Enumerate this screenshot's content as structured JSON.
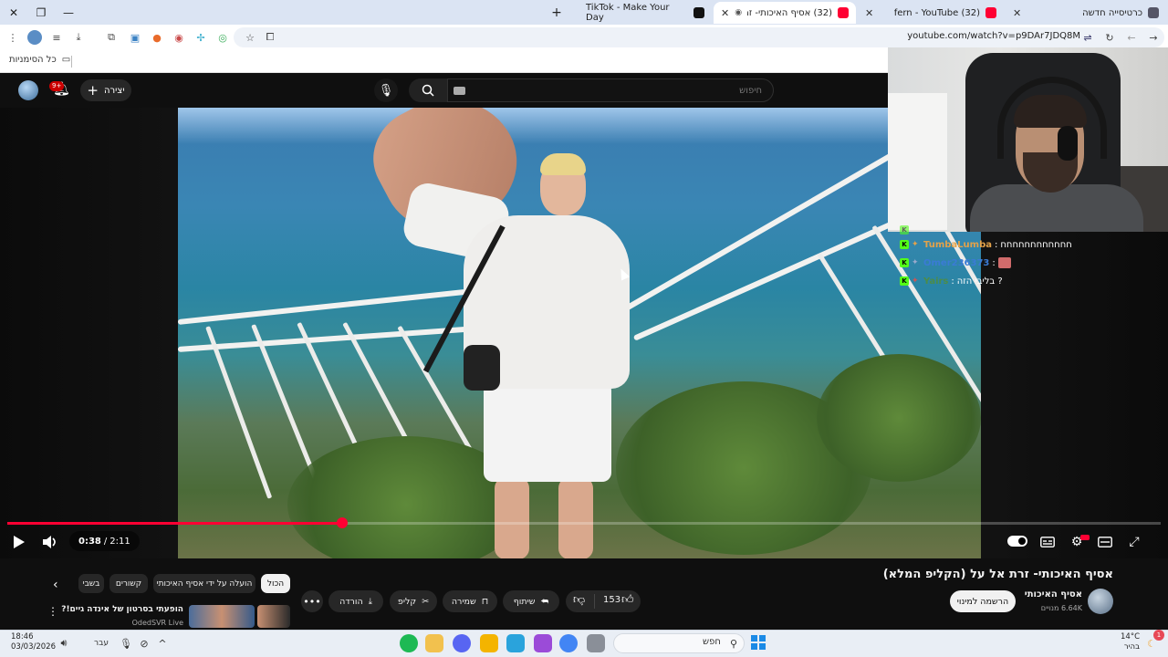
{
  "browser": {
    "tabs": [
      {
        "title": "כרטיסייה חדשה",
        "active": false
      },
      {
        "title": "(32) fern - YouTube",
        "active": false
      },
      {
        "title": "(32) אסיף האיכותי- זרת אל",
        "active": true
      },
      {
        "title": "TikTok - Make Your Day",
        "active": false
      }
    ],
    "new_tab_label": "+",
    "url": "youtube.com/watch?v=p9DAr7JDQ8M",
    "bookmarks_folder": "כל הסימניות"
  },
  "youtube": {
    "search_placeholder": "חיפוש",
    "create_label": "יצירה",
    "notifications_badge": "9+",
    "video": {
      "title": "אסיף האיכותי- זרת אל על (הקליפ המלא)",
      "current_time": "0:38",
      "duration": "2:11",
      "progress": 0.29
    },
    "channel": {
      "name": "אסיף האיכותי",
      "subscribers": "6.64K מנויים",
      "subscribe_label": "הרשמה למינוי"
    },
    "actions": {
      "likes": "153",
      "share": "שיתוף",
      "save": "שמירה",
      "clip": "קליפ",
      "download": "הורדה"
    },
    "chips": [
      "הכול",
      "הועלה על ידי אסיף האיכותי",
      "קשורים",
      "בשבי"
    ],
    "recommendation": {
      "title": "הופעתי בסרטון של אינדה גיים!?",
      "channel": "OdedSVR Live"
    }
  },
  "chat": [
    {
      "user": "TumbaLumba",
      "message": "חחחחחחחחחחחח"
    },
    {
      "user": "Omer236373",
      "message": ""
    },
    {
      "user": "Yairs",
      "message": "בליבי הזה ?"
    }
  ],
  "taskbar": {
    "time": "18:46",
    "date": "03/03/2026",
    "language": "עבר",
    "search_label": "חפש",
    "temperature": "14°C",
    "weather": "בהיר",
    "notif_count": "1"
  }
}
